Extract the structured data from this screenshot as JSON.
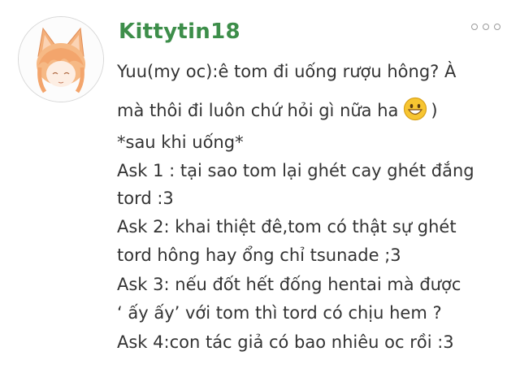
{
  "comment": {
    "username": "Kittytin18",
    "lines": [
      "Yuu(my oc):ê tom đi uống rượu hông? À",
      "mà thôi đi luôn chứ hỏi gì nữa ha",
      ")",
      "*sau khi uống*",
      "Ask 1 : tại sao tom lại ghét cay ghét đắng",
      "tord :3",
      "Ask 2: khai thiệt đê,tom có thật sự ghét",
      "tord hông hay ổng chỉ tsunade ;3",
      "Ask 3: nếu đốt hết đống hentai mà được",
      "‘ ấy ấy’ với tom thì tord có chịu hem ?",
      "Ask 4:con tác giả có bao nhiêu oc rồi :3"
    ],
    "emoji": "grinning-face-emoji"
  },
  "colors": {
    "username": "#3d8e4a",
    "text": "#333333",
    "emoji_fill": "#f7c531"
  }
}
